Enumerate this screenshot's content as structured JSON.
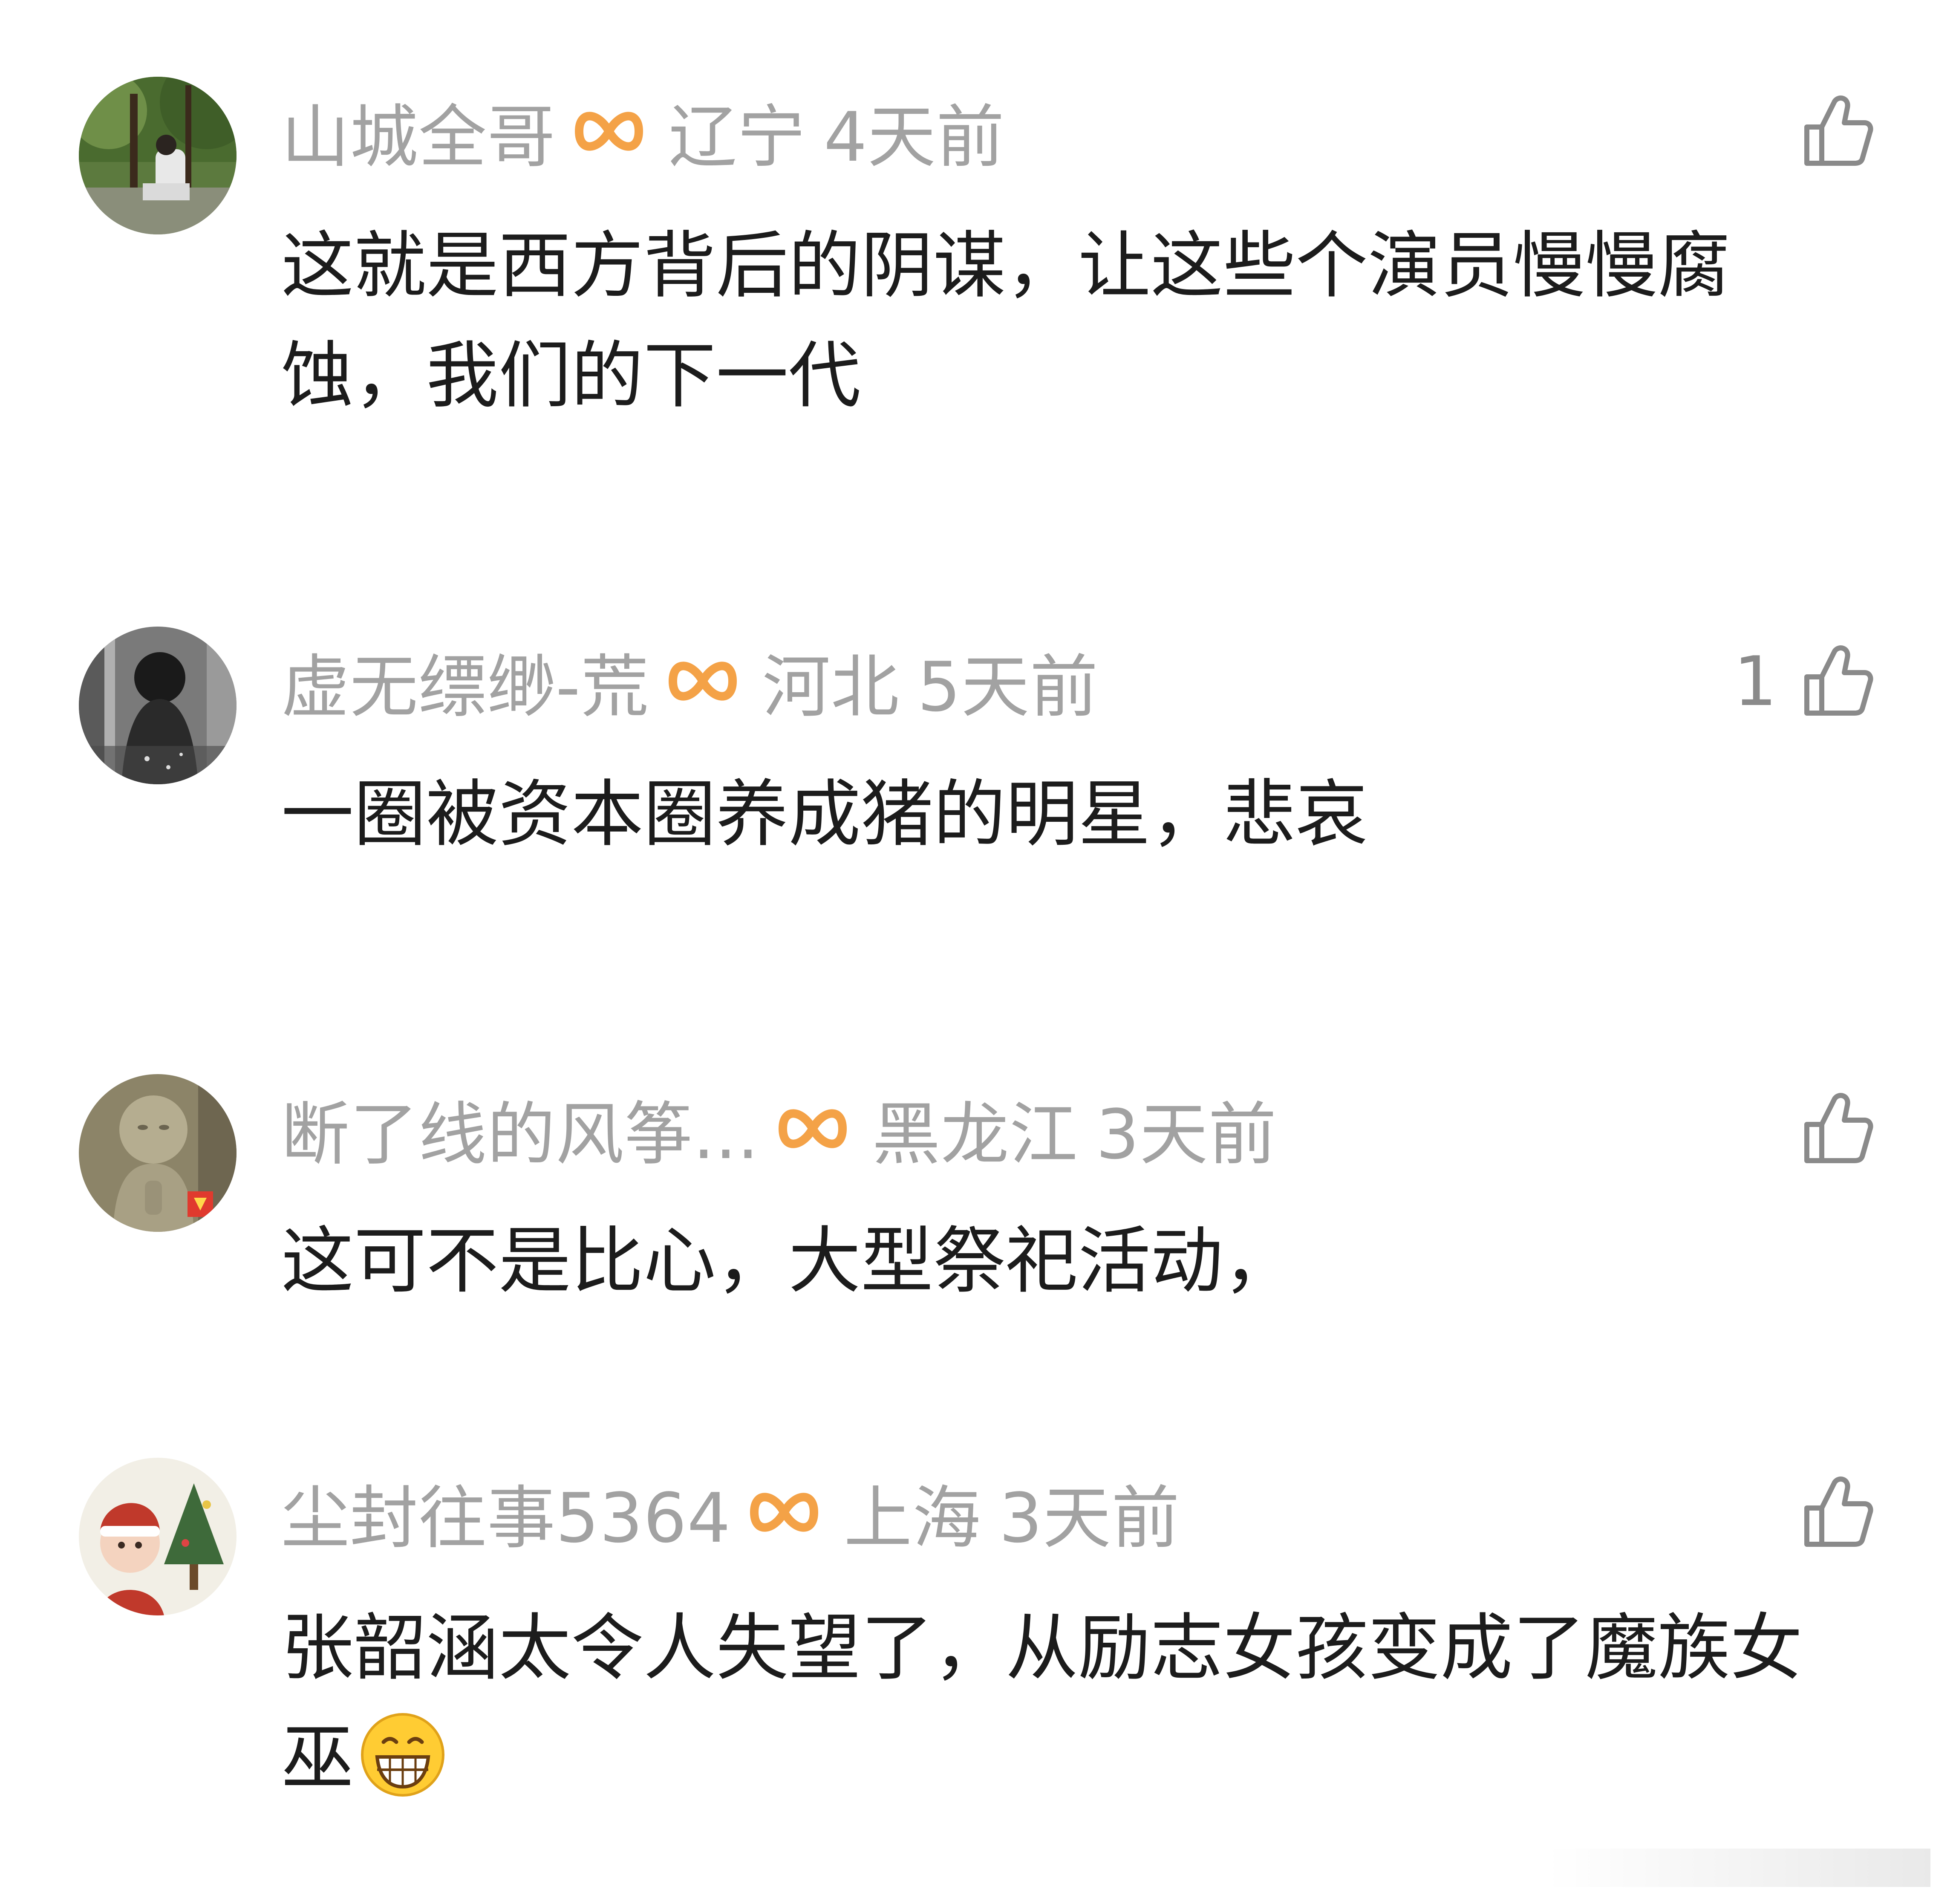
{
  "comments": [
    {
      "username": "山城全哥",
      "location": "辽宁",
      "time": "4天前",
      "like_count": "",
      "text": "这就是西方背后的阴谋，让这些个演员慢慢腐蚀，我们的下一代",
      "avatar_icon": "avatar-forest-person"
    },
    {
      "username": "虚无缥缈-荒",
      "location": "河北",
      "time": "5天前",
      "like_count": "1",
      "text": "一圈被资本圈养成猪的明星，悲哀",
      "avatar_icon": "avatar-dark-figure"
    },
    {
      "username": "断了线的风筝...",
      "location": "黑龙江",
      "time": "3天前",
      "like_count": "",
      "text": "这可不是比心，大型祭祀活动，",
      "avatar_icon": "avatar-stone-statue"
    },
    {
      "username": "尘封往事5364",
      "location": "上海",
      "time": "3天前",
      "like_count": "",
      "text": "张韶涵太令人失望了，从励志女孩变成了魔族女巫",
      "emoji": "grin-emoji",
      "avatar_icon": "avatar-baby-christmas"
    }
  ],
  "colors": {
    "meta_gray": "#a2a2a2",
    "vip_orange": "#f4a247",
    "body_text": "#1c1c1c",
    "like_icon": "#8a8a8a"
  },
  "icons": {
    "vip": "vip-infinity-icon",
    "like": "thumbs-up-icon"
  }
}
